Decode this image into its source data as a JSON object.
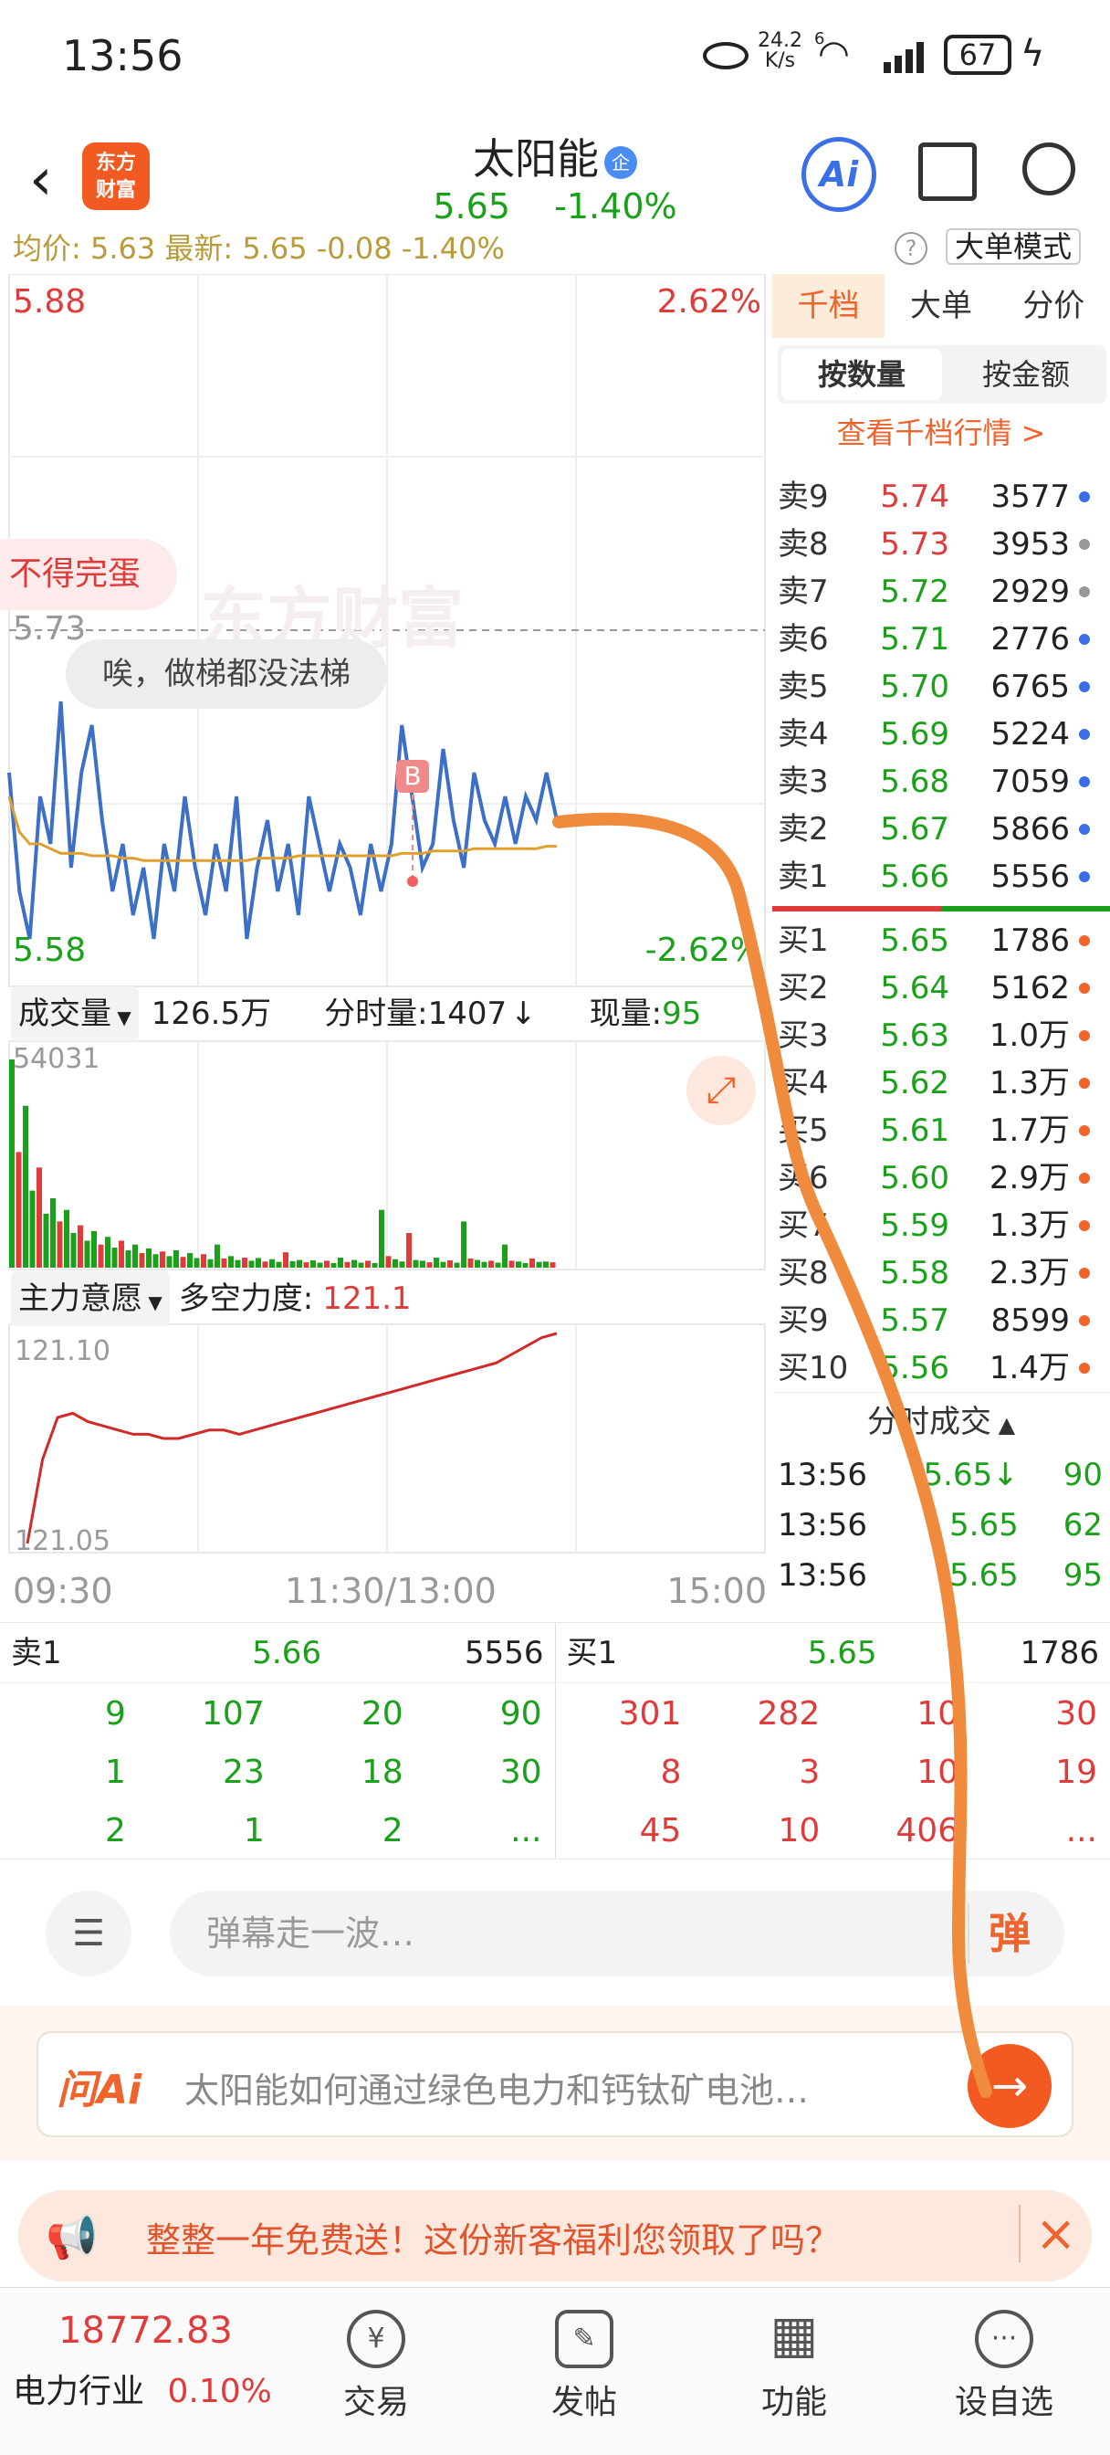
{
  "status_bar": {
    "time": "13:56",
    "net_speed_value": "24.2",
    "net_speed_unit": "K/s",
    "signal_label": "6",
    "battery": "67"
  },
  "header": {
    "back_icon": "chevron-left-icon",
    "logo_line1": "东方",
    "logo_line2": "财富",
    "stock_name": "太阳能",
    "badge": "企",
    "price": "5.65",
    "change_pct": "-1.40%",
    "ai_label": "Ai"
  },
  "info_bar": {
    "text": "均价: 5.63 最新: 5.65 -0.08 -1.40%",
    "help": "?",
    "mode_button": "大单模式"
  },
  "chart": {
    "top_price": "5.88",
    "top_pct": "2.62%",
    "bottom_price": "5.58",
    "bottom_pct": "-2.62%",
    "ref_price": "5.73",
    "watermark": "东方财富",
    "bubble1": "不得完蛋",
    "bubble2": "唉，做梯都没法梯",
    "marker": "B",
    "volume_header": {
      "selector": "成交量",
      "total": "126.5万",
      "period_label": "分时量:",
      "period_value": "1407",
      "period_arrow": "↓",
      "current_label": "现量:",
      "current_value": "95"
    },
    "volume_max": "54031",
    "force_header": {
      "selector": "主力意愿",
      "label": "多空力度:",
      "value": "121.1"
    },
    "force_top": "121.10",
    "force_bottom": "121.05",
    "time_axis": {
      "start": "09:30",
      "mid": "11:30/13:00",
      "end": "15:00"
    }
  },
  "chart_data": [
    {
      "type": "line",
      "title": "",
      "series": [
        {
          "name": "",
          "values": [
            5.67,
            5.62,
            5.6,
            5.66,
            5.64,
            5.7,
            5.63,
            5.67,
            5.69,
            5.65,
            5.62,
            5.64,
            5.61,
            5.63,
            5.6,
            5.64,
            5.62,
            5.66,
            5.63,
            5.61,
            5.64,
            5.62,
            5.66,
            5.6,
            5.63,
            5.65,
            5.62,
            5.64,
            5.61,
            5.66,
            5.64,
            5.62,
            5.64,
            5.63,
            5.61,
            5.64,
            5.62,
            5.64,
            5.69,
            5.66,
            5.63,
            5.64,
            5.68,
            5.65,
            5.63,
            5.67,
            5.65,
            5.64,
            5.66,
            5.64,
            5.66,
            5.65,
            5.67,
            5.65
          ]
        },
        {
          "name": "",
          "values": [
            5.66,
            5.645,
            5.64,
            5.64,
            5.638,
            5.636,
            5.636,
            5.636,
            5.635,
            5.635,
            5.635,
            5.634,
            5.634,
            5.633,
            5.633,
            5.633,
            5.633,
            5.633,
            5.633,
            5.633,
            5.633,
            5.633,
            5.633,
            5.633,
            5.634,
            5.634,
            5.634,
            5.634,
            5.635,
            5.635,
            5.635,
            5.635,
            5.635,
            5.635,
            5.635,
            5.635,
            5.635,
            5.635,
            5.636,
            5.636,
            5.636,
            5.637,
            5.637,
            5.637,
            5.637,
            5.638,
            5.638,
            5.638,
            5.638,
            5.638,
            5.638,
            5.638,
            5.639,
            5.639
          ]
        }
      ],
      "ylim": [
        5.58,
        5.88
      ],
      "xlabel": "",
      "ylabel": ""
    },
    {
      "type": "bar",
      "title": "",
      "ylim": [
        0,
        54031
      ],
      "values": [
        54031,
        30000,
        42000,
        20000,
        26000,
        14000,
        18000,
        12000,
        15000,
        9000,
        11000,
        7000,
        9500,
        6000,
        8000,
        5200,
        7000,
        4500,
        6000,
        3800,
        5000,
        3500,
        4200,
        3000,
        4500,
        2800,
        3800,
        2500,
        3500,
        2200,
        6000,
        2400,
        3000,
        2000,
        2600,
        1800,
        2500,
        1600,
        2200,
        1500,
        4000,
        1700,
        2000,
        1400,
        1900,
        1300,
        1800,
        1200,
        2600,
        1500,
        2000,
        1300,
        1800,
        1200,
        15000,
        3000,
        2200,
        1600,
        9000,
        2000,
        1800,
        1400,
        2600,
        1500,
        1900,
        1300,
        12000,
        2400,
        2000,
        1500,
        1800,
        1300,
        6000,
        1800,
        1600,
        1200,
        2400,
        1500,
        1600,
        1400
      ]
    },
    {
      "type": "line",
      "title": "",
      "series": [
        {
          "name": "",
          "values": [
            121.05,
            121.07,
            121.08,
            121.081,
            121.079,
            121.078,
            121.077,
            121.076,
            121.076,
            121.075,
            121.075,
            121.076,
            121.077,
            121.077,
            121.076,
            121.077,
            121.078,
            121.079,
            121.08,
            121.081,
            121.082,
            121.083,
            121.084,
            121.085,
            121.086,
            121.087,
            121.088,
            121.089,
            121.09,
            121.091,
            121.092,
            121.093,
            121.095,
            121.097,
            121.099,
            121.1
          ]
        }
      ],
      "ylim": [
        121.05,
        121.1
      ]
    }
  ],
  "right_panel": {
    "tabs": [
      "千档",
      "大单",
      "分价"
    ],
    "subtabs": [
      "按数量",
      "按金额"
    ],
    "link": "查看千档行情 >",
    "asks": [
      {
        "label": "卖9",
        "price": "5.74",
        "vol": "3577",
        "dot": "#3b6fe8"
      },
      {
        "label": "卖8",
        "price": "5.73",
        "vol": "3953",
        "dot": "#999999"
      },
      {
        "label": "卖7",
        "price": "5.72",
        "vol": "2929",
        "dot": "#999999"
      },
      {
        "label": "卖6",
        "price": "5.71",
        "vol": "2776",
        "dot": "#3b6fe8"
      },
      {
        "label": "卖5",
        "price": "5.70",
        "vol": "6765",
        "dot": "#3b6fe8"
      },
      {
        "label": "卖4",
        "price": "5.69",
        "vol": "5224",
        "dot": "#3b6fe8"
      },
      {
        "label": "卖3",
        "price": "5.68",
        "vol": "7059",
        "dot": "#3b6fe8"
      },
      {
        "label": "卖2",
        "price": "5.67",
        "vol": "5866",
        "dot": "#3b6fe8"
      },
      {
        "label": "卖1",
        "price": "5.66",
        "vol": "5556",
        "dot": "#3b6fe8"
      }
    ],
    "bids": [
      {
        "label": "买1",
        "price": "5.65",
        "vol": "1786",
        "dot": "#f0632c"
      },
      {
        "label": "买2",
        "price": "5.64",
        "vol": "5162",
        "dot": "#f0632c"
      },
      {
        "label": "买3",
        "price": "5.63",
        "vol": "1.0万",
        "dot": "#f0632c"
      },
      {
        "label": "买4",
        "price": "5.62",
        "vol": "1.3万",
        "dot": "#f0632c"
      },
      {
        "label": "买5",
        "price": "5.61",
        "vol": "1.7万",
        "dot": "#f0632c"
      },
      {
        "label": "买6",
        "price": "5.60",
        "vol": "2.9万",
        "dot": "#f0632c"
      },
      {
        "label": "买7",
        "price": "5.59",
        "vol": "1.3万",
        "dot": "#f0632c"
      },
      {
        "label": "买8",
        "price": "5.58",
        "vol": "2.3万",
        "dot": "#f0632c"
      },
      {
        "label": "买9",
        "price": "5.57",
        "vol": "8599",
        "dot": "#f0632c"
      },
      {
        "label": "买10",
        "price": "5.56",
        "vol": "1.4万",
        "dot": "#f0632c"
      }
    ],
    "trades_header": "分时成交",
    "trades": [
      {
        "time": "13:56",
        "price": "5.65↓",
        "vol": "90"
      },
      {
        "time": "13:56",
        "price": "5.65",
        "vol": "62"
      },
      {
        "time": "13:56",
        "price": "5.65",
        "vol": "95"
      }
    ]
  },
  "bottom_quote": {
    "sell_label": "卖1",
    "sell_price": "5.66",
    "sell_vol": "5556",
    "buy_label": "买1",
    "buy_price": "5.65",
    "buy_vol": "1786",
    "sell_rows": [
      [
        "9",
        "107",
        "20",
        "90"
      ],
      [
        "1",
        "23",
        "18",
        "30"
      ],
      [
        "2",
        "1",
        "2",
        "..."
      ]
    ],
    "buy_rows": [
      [
        "301",
        "282",
        "10",
        "30"
      ],
      [
        "8",
        "3",
        "10",
        "19"
      ],
      [
        "45",
        "10",
        "406",
        "..."
      ]
    ]
  },
  "danmu": {
    "placeholder": "弹幕走一波…",
    "button": "弹"
  },
  "ask_ai": {
    "brand": "问Ai",
    "placeholder": "太阳能如何通过绿色电力和钙钛矿电池…"
  },
  "promo": {
    "text": "整整一年免费送！这份新客福利您领取了吗？"
  },
  "bottom_nav": {
    "index_value": "18772.83",
    "index_name": "电力行业",
    "index_change": "0.10%",
    "items": [
      {
        "label": "交易",
        "icon": "¥"
      },
      {
        "label": "发帖",
        "icon": "✎"
      },
      {
        "label": "功能",
        "icon": "▦"
      },
      {
        "label": "设自选",
        "icon": "···"
      }
    ]
  }
}
